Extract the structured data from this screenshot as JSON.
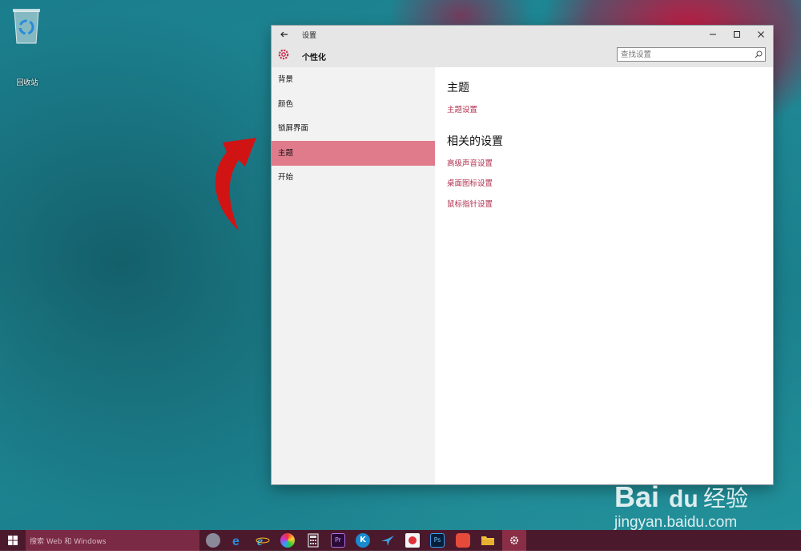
{
  "desktop": {
    "recycle_bin_label": "回收站"
  },
  "window": {
    "title": "设置",
    "page_title": "个性化",
    "search": {
      "placeholder": "查找设置"
    },
    "nav_items": [
      {
        "label": "背景",
        "active": false
      },
      {
        "label": "颜色",
        "active": false
      },
      {
        "label": "锁屏界面",
        "active": false
      },
      {
        "label": "主题",
        "active": true
      },
      {
        "label": "开始",
        "active": false
      }
    ],
    "content": {
      "section1_title": "主题",
      "section1_link": "主题设置",
      "section2_title": "相关的设置",
      "related_links": [
        "高级声音设置",
        "桌面图标设置",
        "鼠标指针设置"
      ]
    }
  },
  "taskbar": {
    "search_placeholder": "搜索 Web 和 Windows"
  },
  "watermark": {
    "brand": "Bai",
    "brand2": "du",
    "suffix": "经验",
    "url": "jingyan.baidu.com"
  },
  "colors": {
    "accent": "#e07b8c",
    "link": "#b0304e",
    "taskbar": "#4a1a2c"
  }
}
